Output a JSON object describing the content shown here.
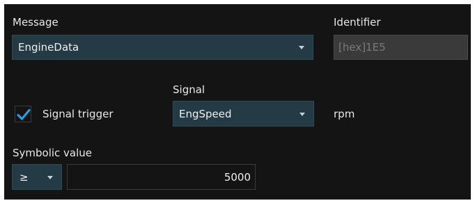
{
  "message": {
    "label": "Message",
    "selected": "EngineData"
  },
  "identifier": {
    "label": "Identifier",
    "value": "[hex]1E5"
  },
  "signal": {
    "label": "Signal",
    "selected": "EngSpeed",
    "unit": "rpm"
  },
  "signal_trigger": {
    "label": "Signal trigger",
    "checked": true,
    "check_color": "#2a9fd8"
  },
  "symbolic_value": {
    "label": "Symbolic value",
    "operator": "≥",
    "value": "5000"
  },
  "icons": [
    "checkmark-icon",
    "chevron-down-icon"
  ]
}
